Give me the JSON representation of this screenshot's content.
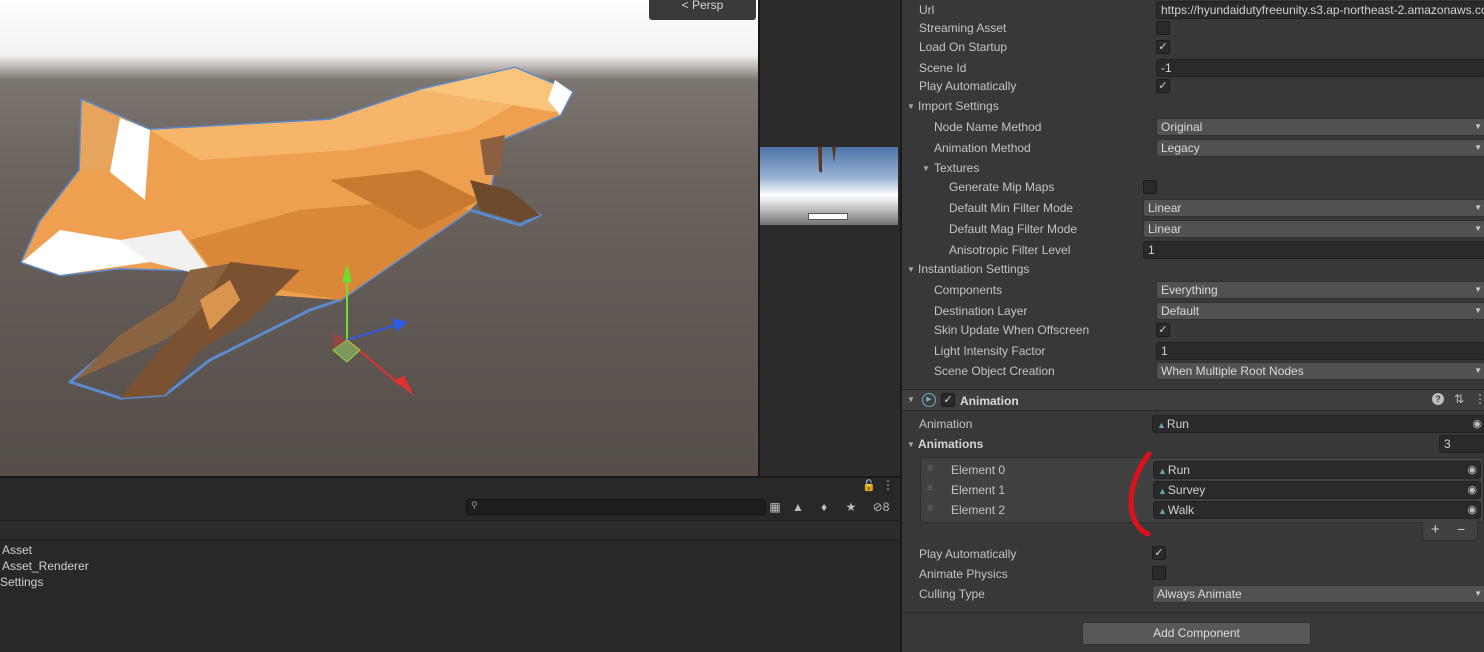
{
  "scene": {
    "persp_label": "< Persp"
  },
  "hierarchy": {
    "rows": [
      "Asset",
      "Asset_Renderer",
      "Settings"
    ],
    "hidden_count": "8"
  },
  "inspector": {
    "url_label": "Url",
    "url_value": "https://hyundaidutyfreeunity.s3.ap-northeast-2.amazonaws.com",
    "streaming_asset_label": "Streaming Asset",
    "streaming_asset_checked": false,
    "load_on_startup_label": "Load On Startup",
    "load_on_startup_checked": true,
    "scene_id_label": "Scene Id",
    "scene_id_value": "-1",
    "play_auto_label": "Play Automatically",
    "play_auto_checked": true,
    "import_settings": {
      "label": "Import Settings",
      "node_name_method_label": "Node Name Method",
      "node_name_method_value": "Original",
      "animation_method_label": "Animation Method",
      "animation_method_value": "Legacy",
      "textures": {
        "label": "Textures",
        "mip_maps_label": "Generate Mip Maps",
        "mip_maps_checked": false,
        "min_filter_label": "Default Min Filter Mode",
        "min_filter_value": "Linear",
        "mag_filter_label": "Default Mag Filter Mode",
        "mag_filter_value": "Linear",
        "aniso_label": "Anisotropic Filter Level",
        "aniso_value": "1"
      }
    },
    "instantiation_settings": {
      "label": "Instantiation Settings",
      "components_label": "Components",
      "components_value": "Everything",
      "dest_layer_label": "Destination Layer",
      "dest_layer_value": "Default",
      "skin_update_label": "Skin Update When Offscreen",
      "skin_update_checked": true,
      "light_intensity_label": "Light Intensity Factor",
      "light_intensity_value": "1",
      "scene_object_label": "Scene Object Creation",
      "scene_object_value": "When Multiple Root Nodes"
    },
    "animation_component": {
      "title": "Animation",
      "enabled": true,
      "animation_label": "Animation",
      "animation_value": "Run",
      "animations_label": "Animations",
      "animations_count": "3",
      "elements": [
        {
          "label": "Element 0",
          "value": "Run"
        },
        {
          "label": "Element 1",
          "value": "Survey"
        },
        {
          "label": "Element 2",
          "value": "Walk"
        }
      ],
      "add_symbol": "+",
      "remove_symbol": "−",
      "play_auto_label": "Play Automatically",
      "play_auto_checked": true,
      "animate_physics_label": "Animate Physics",
      "animate_physics_checked": false,
      "culling_type_label": "Culling Type",
      "culling_type_value": "Always Animate"
    },
    "add_component_label": "Add Component"
  },
  "colors": {
    "annotation_red": "#e0101a",
    "fox_orange": "#f0a050",
    "selection_outline": "#5a8ad0"
  }
}
